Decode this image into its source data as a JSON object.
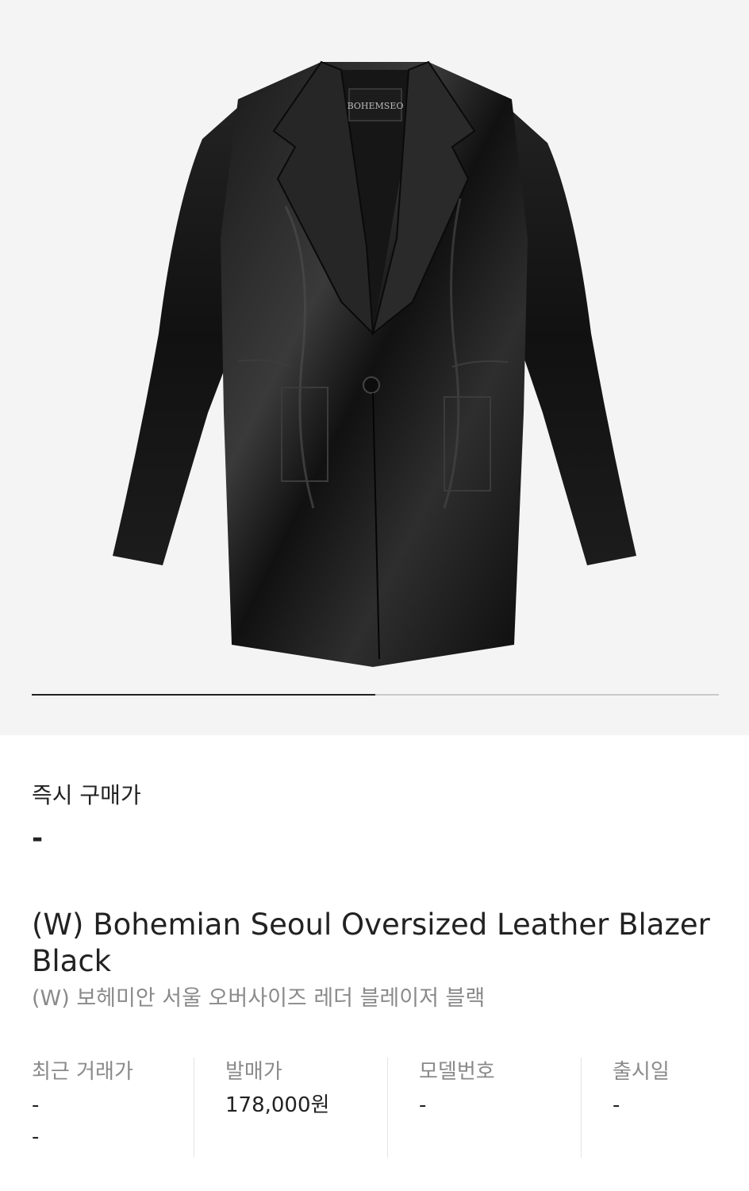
{
  "product_image": {
    "brand_tag_text": "BOHEMSEO",
    "alt": "product-photo"
  },
  "carousel": {
    "current_index": 1,
    "total": 2,
    "progress_fraction": 0.5
  },
  "instant_buy": {
    "label": "즉시 구매가",
    "value": "-"
  },
  "product": {
    "name_en": "(W) Bohemian Seoul Oversized Leather Blazer Black",
    "name_ko": "(W) 보헤미안 서울 오버사이즈 레더 블레이저 블랙"
  },
  "info": [
    {
      "label": "최근 거래가",
      "value": "-",
      "sub": "-"
    },
    {
      "label": "발매가",
      "value": "178,000원"
    },
    {
      "label": "모델번호",
      "value": "-"
    },
    {
      "label": "출시일",
      "value": "-"
    }
  ],
  "colors": {
    "hero_bg": "#f4f4f4",
    "text_primary": "#222222",
    "text_secondary": "#8a8a8a",
    "indicator_active": "#222222",
    "indicator_track": "#c9c9c9"
  }
}
